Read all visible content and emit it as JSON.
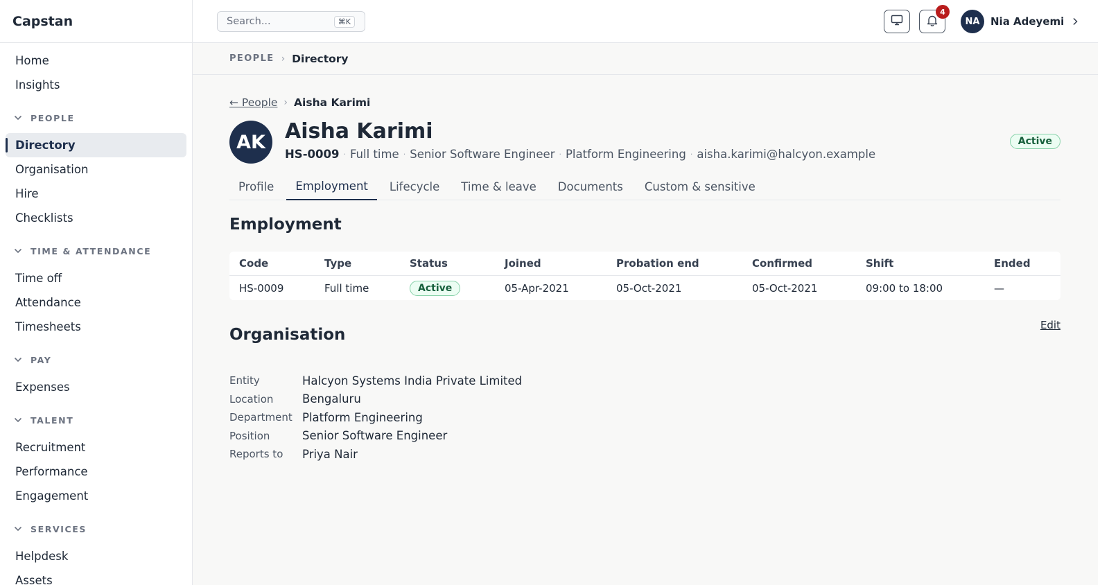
{
  "app": {
    "name": "Capstan"
  },
  "sidebar": {
    "top_items": [
      {
        "label": "Home"
      },
      {
        "label": "Insights"
      }
    ],
    "groups": [
      {
        "title": "PEOPLE",
        "items": [
          {
            "label": "Directory",
            "active": true
          },
          {
            "label": "Organisation"
          },
          {
            "label": "Hire"
          },
          {
            "label": "Checklists"
          }
        ]
      },
      {
        "title": "TIME & ATTENDANCE",
        "items": [
          {
            "label": "Time off"
          },
          {
            "label": "Attendance"
          },
          {
            "label": "Timesheets"
          }
        ]
      },
      {
        "title": "PAY",
        "items": [
          {
            "label": "Expenses"
          }
        ]
      },
      {
        "title": "TALENT",
        "items": [
          {
            "label": "Recruitment"
          },
          {
            "label": "Performance"
          },
          {
            "label": "Engagement"
          }
        ]
      },
      {
        "title": "SERVICES",
        "items": [
          {
            "label": "Helpdesk"
          },
          {
            "label": "Assets"
          }
        ]
      }
    ]
  },
  "topbar": {
    "search_placeholder": "Search...",
    "search_shortcut": "⌘K",
    "notification_count": "4",
    "user": {
      "initials": "NA",
      "name": "Nia Adeyemi"
    }
  },
  "breadcrumb": {
    "section": "PEOPLE",
    "current": "Directory"
  },
  "person": {
    "back_label": "← People",
    "crumb_current": "Aisha Karimi",
    "initials": "AK",
    "name": "Aisha Karimi",
    "code": "HS-0009",
    "type": "Full time",
    "title": "Senior Software Engineer",
    "department": "Platform Engineering",
    "email": "aisha.karimi@halcyon.example",
    "status": "Active"
  },
  "tabs": [
    {
      "label": "Profile"
    },
    {
      "label": "Employment",
      "active": true
    },
    {
      "label": "Lifecycle"
    },
    {
      "label": "Time & leave"
    },
    {
      "label": "Documents"
    },
    {
      "label": "Custom & sensitive"
    }
  ],
  "employment": {
    "title": "Employment",
    "columns": [
      "Code",
      "Type",
      "Status",
      "Joined",
      "Probation end",
      "Confirmed",
      "Shift",
      "Ended"
    ],
    "row": {
      "code": "HS-0009",
      "type": "Full time",
      "status": "Active",
      "joined": "05-Apr-2021",
      "probation_end": "05-Oct-2021",
      "confirmed": "05-Oct-2021",
      "shift": "09:00 to 18:00",
      "ended": "—"
    }
  },
  "organisation": {
    "title": "Organisation",
    "edit_label": "Edit",
    "fields": [
      {
        "label": "Entity",
        "value": "Halcyon Systems India Private Limited"
      },
      {
        "label": "Location",
        "value": "Bengaluru"
      },
      {
        "label": "Department",
        "value": "Platform Engineering"
      },
      {
        "label": "Position",
        "value": "Senior Software Engineer"
      },
      {
        "label": "Reports to",
        "value": "Priya Nair"
      }
    ]
  },
  "colors": {
    "primary": "#1e2f4d",
    "status_green": "#17603c",
    "badge_red": "#b91c1c"
  }
}
